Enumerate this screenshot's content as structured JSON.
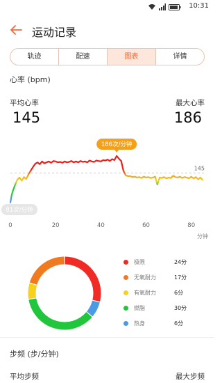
{
  "status_bar": {
    "time": "10:31"
  },
  "header": {
    "title": "运动记录"
  },
  "tabs": [
    {
      "label": "轨迹",
      "active": false
    },
    {
      "label": "配速",
      "active": false
    },
    {
      "label": "图表",
      "active": true
    },
    {
      "label": "详情",
      "active": false
    }
  ],
  "heart_rate": {
    "section_title": "心率 (bpm)",
    "avg_label": "平均心率",
    "avg_value": "145",
    "max_label": "最大心率",
    "max_value": "186",
    "max_badge": "186次/分钟",
    "min_badge": "81次/分钟",
    "avg_line_label": "145",
    "x_unit": "分钟"
  },
  "chart_data": {
    "type": "line",
    "title": "",
    "xlabel": "分钟",
    "ylabel": "",
    "xlim": [
      0,
      85
    ],
    "ylim": [
      70,
      200
    ],
    "x_ticks": [
      0,
      20,
      40,
      60,
      80
    ],
    "annotations": {
      "max": 186,
      "min": 81,
      "avg": 145
    },
    "series": [
      {
        "x": [
          0,
          0.5,
          1,
          2,
          3,
          4,
          5,
          6,
          7,
          8,
          9,
          10,
          11,
          12,
          13,
          14,
          15,
          16,
          17,
          18,
          19,
          20,
          21,
          22,
          23,
          24,
          25,
          26,
          27,
          28,
          29,
          30,
          31,
          32,
          33,
          34,
          35,
          36,
          37,
          38,
          39,
          40,
          41,
          42,
          43,
          44,
          45,
          46,
          47,
          48,
          49,
          50,
          51,
          52,
          53,
          54,
          55,
          56,
          57,
          58,
          59,
          60,
          61,
          62,
          63,
          64,
          65,
          66,
          67,
          68,
          69,
          70,
          71,
          72,
          73,
          74,
          75,
          76,
          77,
          78,
          79,
          80,
          81,
          82,
          83,
          84,
          85
        ],
        "values": [
          81,
          95,
          105,
          118,
          130,
          135,
          128,
          136,
          132,
          142,
          150,
          158,
          165,
          168,
          164,
          170,
          166,
          168,
          170,
          167,
          171,
          170,
          168,
          169,
          167,
          170,
          168,
          169,
          171,
          168,
          170,
          168,
          171,
          169,
          170,
          168,
          172,
          170,
          169,
          172,
          171,
          170,
          173,
          172,
          174,
          171,
          175,
          173,
          182,
          176,
          171,
          150,
          140,
          138,
          138,
          136,
          137,
          135,
          136,
          134,
          137,
          135,
          136,
          134,
          135,
          137,
          120,
          135,
          134,
          136,
          133,
          135,
          134,
          139,
          136,
          135,
          137,
          134,
          136,
          135,
          133,
          137,
          133,
          136,
          131,
          135,
          130
        ]
      }
    ]
  },
  "zones": {
    "items": [
      {
        "label": "极限",
        "value": "24分",
        "minutes": 24,
        "color": "#f02a25"
      },
      {
        "label": "无氧耐力",
        "value": "17分",
        "minutes": 17,
        "color": "#ef7a1f"
      },
      {
        "label": "有氧耐力",
        "value": "6分",
        "minutes": 6,
        "color": "#f6d21c"
      },
      {
        "label": "燃脂",
        "value": "30分",
        "minutes": 30,
        "color": "#22c63c"
      },
      {
        "label": "热身",
        "value": "6分",
        "minutes": 6,
        "color": "#4a9ae4"
      }
    ]
  },
  "cadence": {
    "section_title": "步频 (步/分钟)",
    "avg_label": "平均步频",
    "max_label": "最大步频"
  }
}
